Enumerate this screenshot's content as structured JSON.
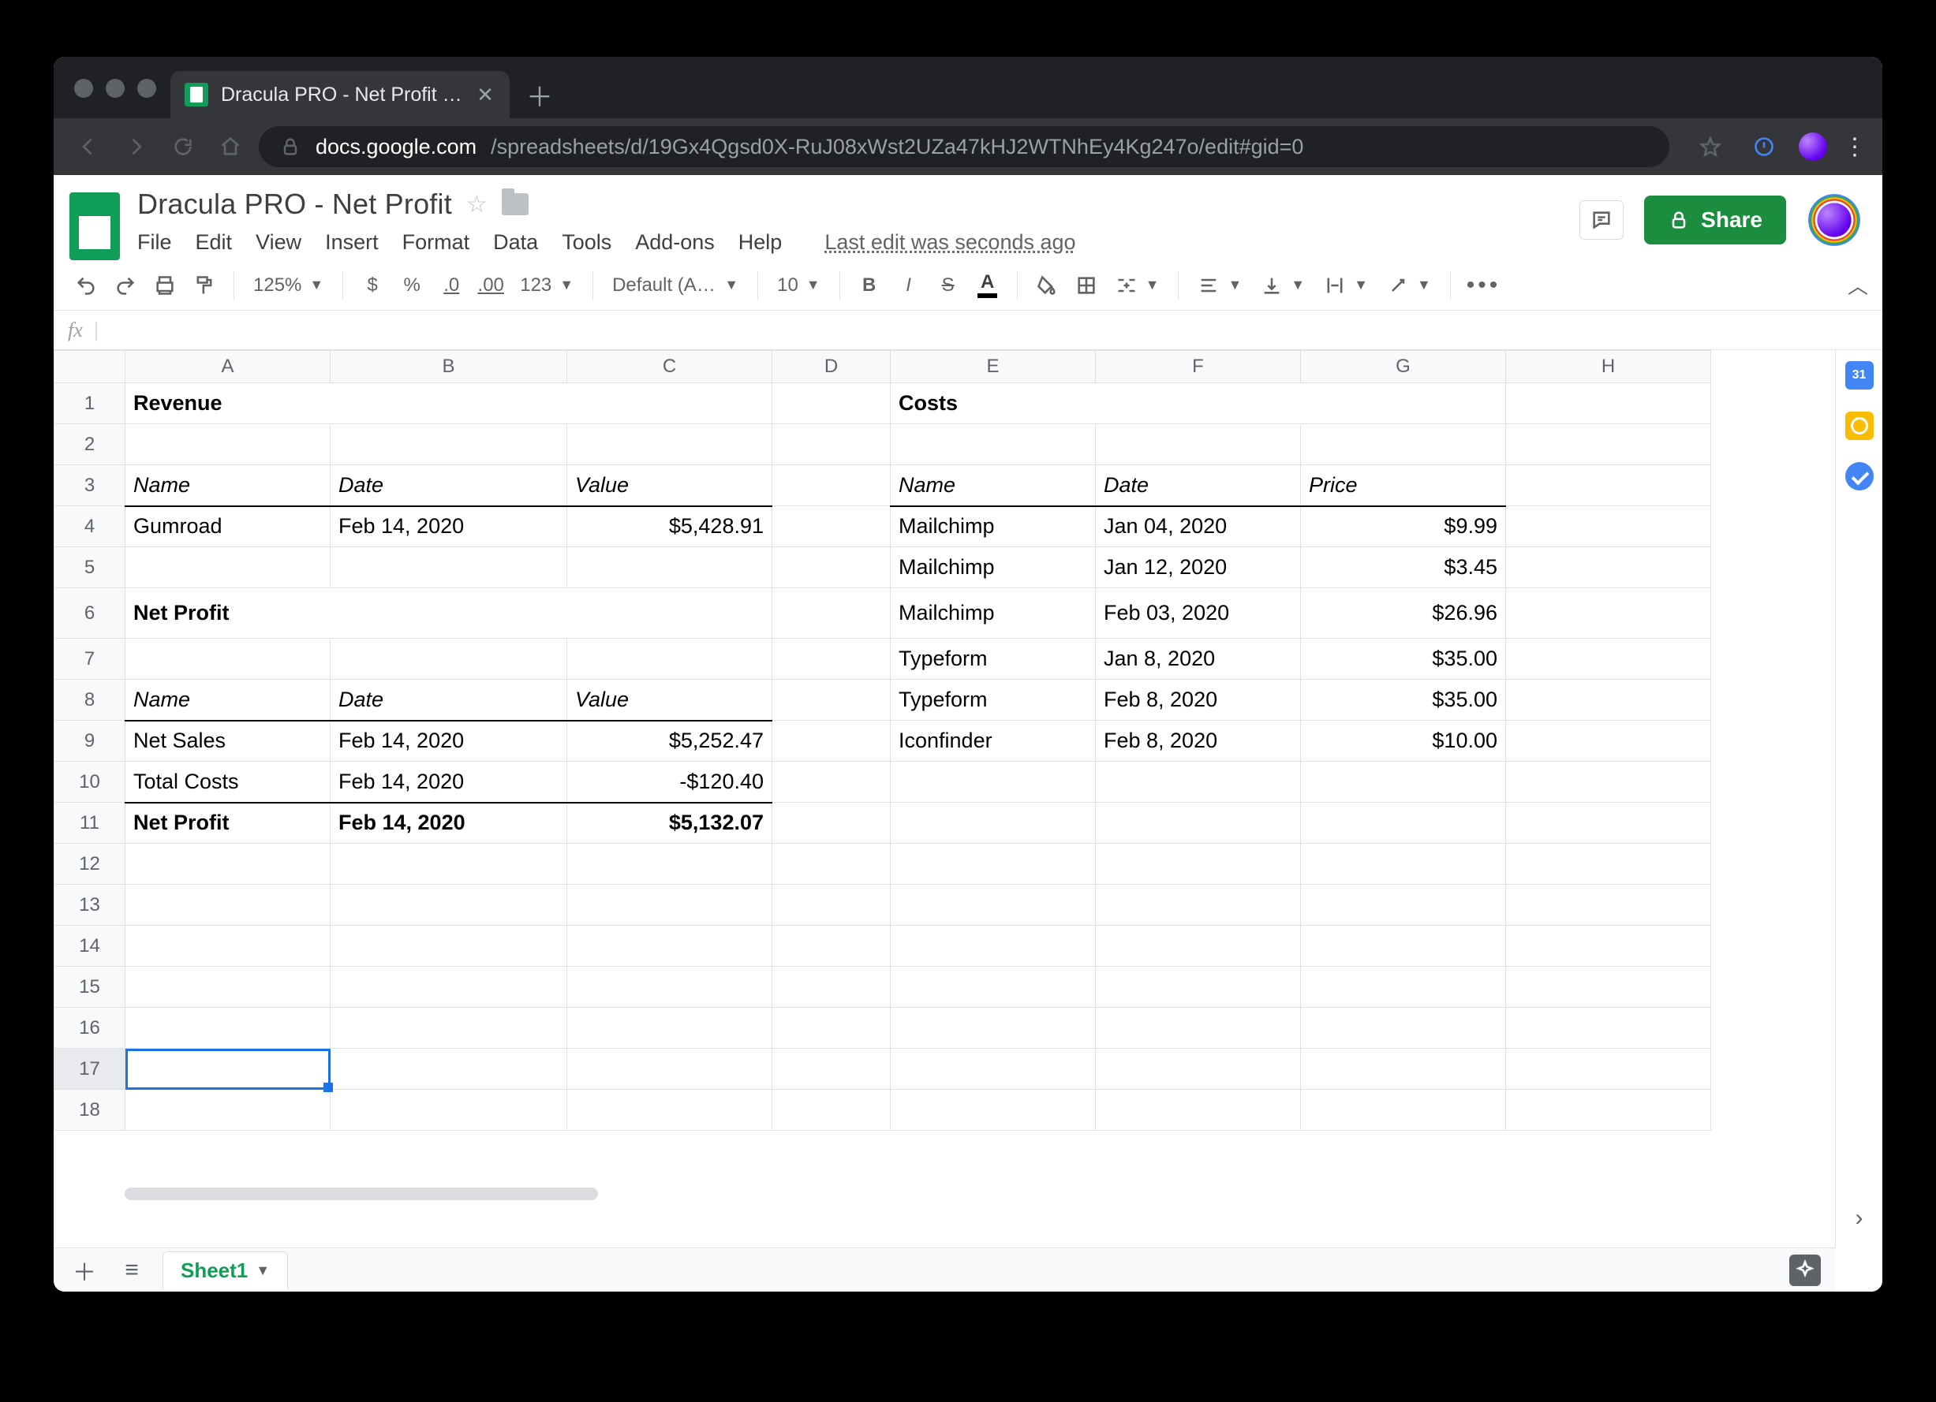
{
  "browser": {
    "tab_title": "Dracula PRO - Net Profit - Googl",
    "url_host": "docs.google.com",
    "url_path": "/spreadsheets/d/19Gx4Qgsd0X-RuJ08xWst2UZa47kHJ2WTNhEy4Kg247o/edit#gid=0"
  },
  "doc": {
    "title": "Dracula PRO - Net Profit",
    "menus": {
      "file": "File",
      "edit": "Edit",
      "view": "View",
      "insert": "Insert",
      "format": "Format",
      "data": "Data",
      "tools": "Tools",
      "addons": "Add-ons",
      "help": "Help",
      "last_edit": "Last edit was seconds ago"
    },
    "share_label": "Share"
  },
  "toolbar": {
    "zoom": "125%",
    "currency": "$",
    "percent": "%",
    "dec_minus": ".0",
    "dec_plus": ".00",
    "more_fmt": "123",
    "font": "Default (Ari...",
    "font_size": "10",
    "bold": "B",
    "italic": "I",
    "strike": "S",
    "textcolor": "A"
  },
  "fx": {
    "label": "fx",
    "value": ""
  },
  "grid": {
    "col_labels": [
      "A",
      "B",
      "C",
      "D",
      "E",
      "F",
      "G",
      "H"
    ],
    "row_labels": [
      "1",
      "2",
      "3",
      "4",
      "5",
      "6",
      "7",
      "8",
      "9",
      "10",
      "11",
      "12",
      "13",
      "14",
      "15",
      "16",
      "17",
      "18"
    ],
    "active_row": "17",
    "cells": {
      "A1": "Revenue",
      "E1": "Costs",
      "A3": "Name",
      "B3": "Date",
      "C3": "Value",
      "E3": "Name",
      "F3": "Date",
      "G3": "Price",
      "A4": "Gumroad",
      "B4": "Feb 14, 2020",
      "C4": "$5,428.91",
      "E4": "Mailchimp",
      "F4": "Jan 04, 2020",
      "G4": "$9.99",
      "E5": "Mailchimp",
      "F5": "Jan 12, 2020",
      "G5": "$3.45",
      "A6": "Net Profit",
      "E6": "Mailchimp",
      "F6": "Feb 03, 2020",
      "G6": "$26.96",
      "E7": "Typeform",
      "F7": "Jan 8, 2020",
      "G7": "$35.00",
      "A8": "Name",
      "B8": "Date",
      "C8": "Value",
      "E8": "Typeform",
      "F8": "Feb 8, 2020",
      "G8": "$35.00",
      "A9": "Net Sales",
      "B9": "Feb 14, 2020",
      "C9": "$5,252.47",
      "E9": "Iconfinder",
      "F9": "Feb 8, 2020",
      "G9": "$10.00",
      "A10": "Total Costs",
      "B10": "Feb 14, 2020",
      "C10": "-$120.40",
      "A11": "Net Profit",
      "B11": "Feb 14, 2020",
      "C11": "$5,132.07"
    }
  },
  "sheettabs": {
    "sheet1": "Sheet1"
  }
}
